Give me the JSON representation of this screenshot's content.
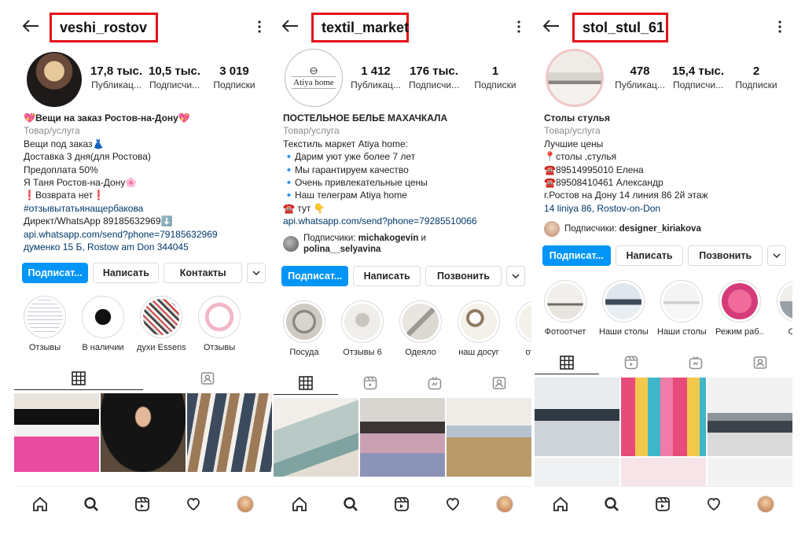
{
  "panels": [
    {
      "username": "veshi_rostov",
      "stats": [
        {
          "value": "17,8 тыс.",
          "label": "Публикац..."
        },
        {
          "value": "10,5 тыс.",
          "label": "Подписчи..."
        },
        {
          "value": "3 019",
          "label": "Подписки"
        }
      ],
      "bio": [
        {
          "text": "💖Вещи на заказ Ростов-на-Дону💖",
          "kind": "name"
        },
        {
          "text": "Товар/услуга",
          "kind": "cat"
        },
        {
          "text": "Вещи под заказ👗",
          "kind": "text"
        },
        {
          "text": "Доставка 3 дня(для Ростова)",
          "kind": "text"
        },
        {
          "text": "Предоплата 50%",
          "kind": "text"
        },
        {
          "text": "Я Таня Ростов-на-Дону🌸",
          "kind": "text"
        },
        {
          "text": "❗Возврата нет❗",
          "kind": "text"
        },
        {
          "text": "#отзывытатьянащербакова",
          "kind": "tag"
        },
        {
          "text": "Директ/WhatsApp 89185632969⬇️",
          "kind": "text"
        },
        {
          "text": "api.whatsapp.com/send?phone=79185632969",
          "kind": "link"
        },
        {
          "text": "думенко 15 Б, Rostow am Don 344045",
          "kind": "link"
        }
      ],
      "buttons": [
        "Подписат...",
        "Написать",
        "Контакты"
      ],
      "highlights": [
        "Отзывы",
        "В наличии",
        "духи Essens",
        "Отзывы"
      ],
      "avatar_color": "#3a2a22"
    },
    {
      "username": "textil_market",
      "stats": [
        {
          "value": "1 412",
          "label": "Публикац..."
        },
        {
          "value": "176 тыс.",
          "label": "Подписчи..."
        },
        {
          "value": "1",
          "label": "Подписки"
        }
      ],
      "avatar_text": "Atiya home",
      "bio": [
        {
          "text": "ПОСТЕЛЬНОЕ БЕЛЬЕ  МАХАЧКАЛА",
          "kind": "name"
        },
        {
          "text": "Товар/услуга",
          "kind": "cat"
        },
        {
          "text": "Текстиль маркет Atiya home:",
          "kind": "text"
        },
        {
          "text": "🔹Дарим уют уже более 7 лет",
          "kind": "text"
        },
        {
          "text": "🔹Мы гарантируем качество",
          "kind": "text"
        },
        {
          "text": "🔹Очень привлекательные цены",
          "kind": "text"
        },
        {
          "text": "🔹Наш телеграм Atiya home",
          "kind": "text"
        },
        {
          "text": "☎️ тут 👇",
          "kind": "text"
        },
        {
          "text": "api.whatsapp.com/send?phone=79285510066",
          "kind": "link"
        }
      ],
      "followed_by_prefix": "Подписчики: ",
      "followed_by_a": "michakogevin",
      "followed_by_and": " и",
      "followed_by_b": "polina__selyavina",
      "buttons": [
        "Подписат...",
        "Написать",
        "Позвонить"
      ],
      "highlights": [
        "Посуда",
        "Отзывы 6",
        "Одеяло",
        "наш досуг",
        "отпра"
      ]
    },
    {
      "username": "stol_stul_61",
      "stats": [
        {
          "value": "478",
          "label": "Публикац..."
        },
        {
          "value": "15,4 тыс.",
          "label": "Подписчи..."
        },
        {
          "value": "2",
          "label": "Подписки"
        }
      ],
      "bio": [
        {
          "text": "Столы стулья",
          "kind": "name"
        },
        {
          "text": "Товар/услуга",
          "kind": "cat"
        },
        {
          "text": "Лучшие цены",
          "kind": "text"
        },
        {
          "text": "📍столы ,стулья",
          "kind": "text"
        },
        {
          "text": "☎️89514995010 Елена",
          "kind": "text"
        },
        {
          "text": "☎️89508410461 Александр",
          "kind": "text"
        },
        {
          "text": "г.Ростов на Дону 14 линия 86 2й этаж",
          "kind": "text"
        },
        {
          "text": "14 liniya 86, Rostov-on-Don",
          "kind": "link"
        }
      ],
      "followed_by_prefix": "Подписчики: ",
      "followed_by_a": "designer_kiriakova",
      "buttons": [
        "Подписат...",
        "Написать",
        "Позвонить"
      ],
      "highlights": [
        "Фотоотчет",
        "Наши столы",
        "Наши столы",
        "Режим раб...",
        "Стул"
      ]
    }
  ],
  "colors": {
    "accent": "#0095f6",
    "highlight_box": "#e3131b",
    "link": "#00376b"
  },
  "icons": [
    "back-arrow-icon",
    "more-dots-icon",
    "grid-icon",
    "reels-icon",
    "igtv-icon",
    "tagged-icon",
    "home-icon",
    "search-icon",
    "reels-nav-icon",
    "heart-icon"
  ]
}
